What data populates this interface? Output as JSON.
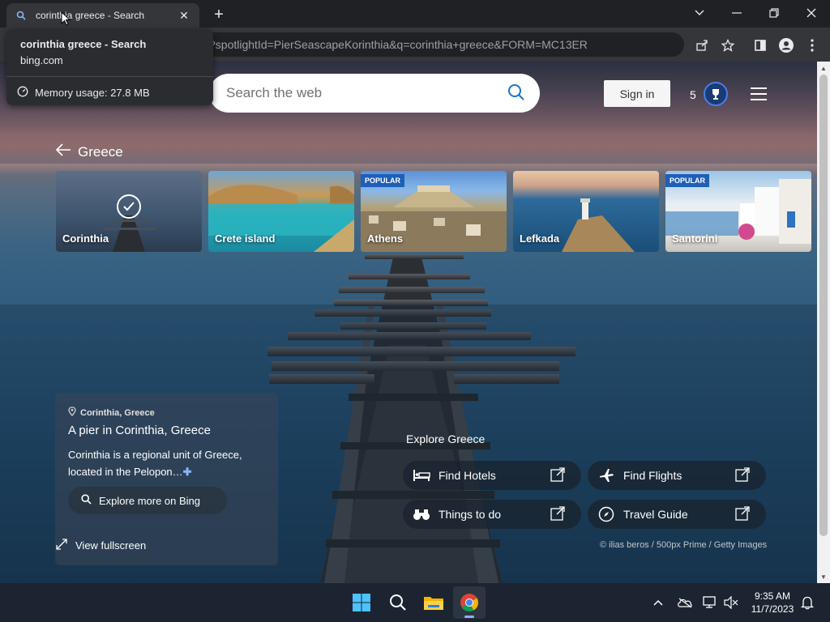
{
  "browser": {
    "tab_title": "corinthia greece - Search",
    "new_tab_symbol": "+",
    "address": "?spotlightId=PierSeascapeKorinthia&q=corinthia+greece&FORM=MC13ER",
    "hover_card": {
      "title": "corinthia greece - Search",
      "domain": "bing.com",
      "memory": "Memory usage: 27.8 MB"
    }
  },
  "header": {
    "search_placeholder": "Search the web",
    "sign_in": "Sign in",
    "rewards_count": "5"
  },
  "collection": {
    "back_label": "Greece",
    "cards": [
      {
        "label": "Corinthia",
        "badge": "",
        "selected": true
      },
      {
        "label": "Crete island",
        "badge": ""
      },
      {
        "label": "Athens",
        "badge": "POPULAR"
      },
      {
        "label": "Lefkada",
        "badge": ""
      },
      {
        "label": "Santorini",
        "badge": "POPULAR"
      }
    ]
  },
  "info": {
    "location": "Corinthia, Greece",
    "headline": "A pier in Corinthia, Greece",
    "description": "Corinthia is a regional unit of Greece, located in the Pelopon…",
    "explore_button": "Explore more on Bing",
    "fullscreen": "View fullscreen"
  },
  "explore": {
    "title": "Explore Greece",
    "links": [
      {
        "label": "Find Hotels",
        "icon": "bed-icon"
      },
      {
        "label": "Find Flights",
        "icon": "airplane-icon"
      },
      {
        "label": "Things to do",
        "icon": "binoculars-icon"
      },
      {
        "label": "Travel Guide",
        "icon": "compass-icon"
      }
    ]
  },
  "credit": "© ilias beros / 500px Prime / Getty Images",
  "taskbar": {
    "time": "9:35 AM",
    "date": "11/7/2023"
  },
  "colors": {
    "accent": "#1f5fb8",
    "taskbar": "#1c2431",
    "chrome_frame": "#202124"
  }
}
